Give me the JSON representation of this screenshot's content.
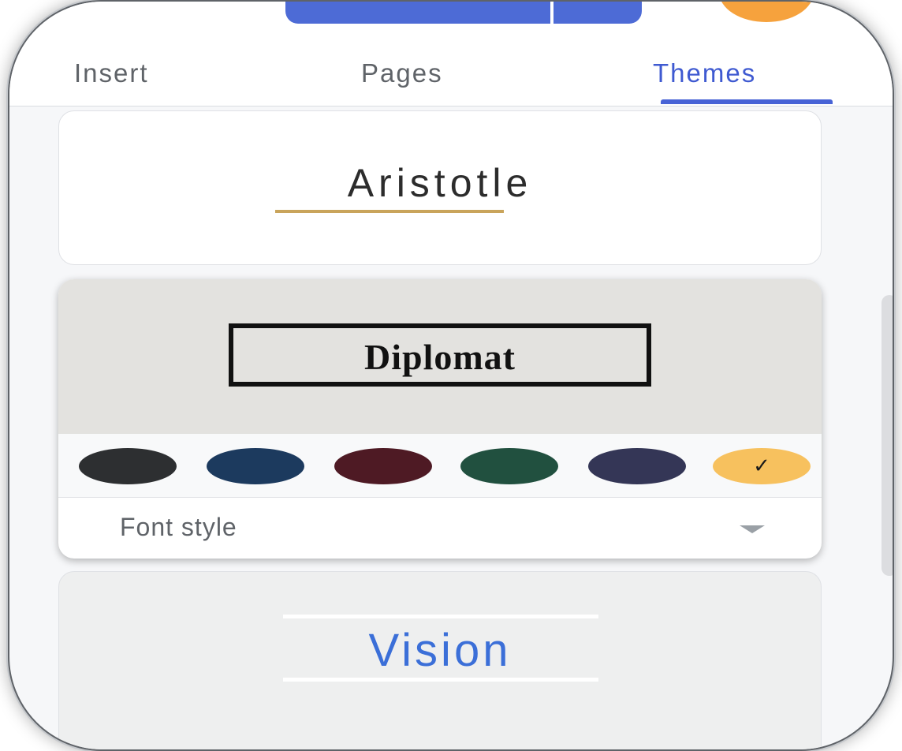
{
  "tabs": [
    {
      "label": "Insert",
      "active": false
    },
    {
      "label": "Pages",
      "active": false
    },
    {
      "label": "Themes",
      "active": true
    }
  ],
  "themes": {
    "aristotle": {
      "title": "Aristotle"
    },
    "diplomat": {
      "title": "Diplomat",
      "color_options": [
        {
          "name": "charcoal",
          "hex": "#2d2f31",
          "selected": false
        },
        {
          "name": "navy",
          "hex": "#1c3a5e",
          "selected": false
        },
        {
          "name": "maroon",
          "hex": "#4e1a24",
          "selected": false
        },
        {
          "name": "forest-green",
          "hex": "#21503f",
          "selected": false
        },
        {
          "name": "indigo",
          "hex": "#343656",
          "selected": false
        },
        {
          "name": "amber",
          "hex": "#f7c15e",
          "selected": true
        }
      ],
      "selected_mark": "✓",
      "font_style_label": "Font style"
    },
    "vision": {
      "title": "Vision"
    }
  },
  "colors": {
    "accent_blue": "#4863d6",
    "aristotle_underline": "#c9a45b",
    "vision_text": "#3b6fd8",
    "avatar": "#f6a23d"
  }
}
